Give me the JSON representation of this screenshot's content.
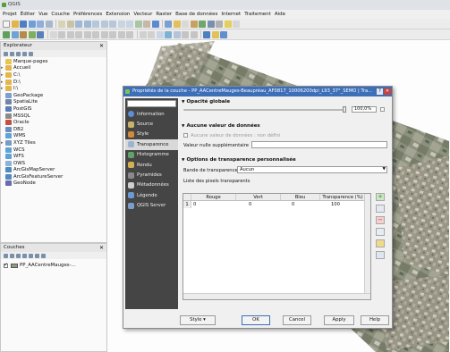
{
  "app": {
    "title": "QGIS"
  },
  "menu": [
    "Projet",
    "Éditer",
    "Vue",
    "Couche",
    "Préférences",
    "Extension",
    "Vecteur",
    "Raster",
    "Base de données",
    "Internet",
    "Traitement",
    "Aide"
  ],
  "explorer": {
    "title": "Explorateur",
    "items": [
      {
        "label": "Marque-pages",
        "icon": "star-icon",
        "color": "#e8c64a"
      },
      {
        "label": "Accueil",
        "icon": "folder-icon",
        "color": "#e5b54d"
      },
      {
        "label": "C:\\",
        "icon": "folder-icon",
        "color": "#e5b54d"
      },
      {
        "label": "D:\\",
        "icon": "folder-icon",
        "color": "#e5b54d"
      },
      {
        "label": "I:\\",
        "icon": "folder-icon",
        "color": "#e5b54d"
      },
      {
        "label": "GeoPackage",
        "icon": "geopackage-icon",
        "color": "#7b9fd4"
      },
      {
        "label": "SpatiaLite",
        "icon": "spatialite-icon",
        "color": "#6f86a5"
      },
      {
        "label": "PostGIS",
        "icon": "postgis-icon",
        "color": "#5a7db5"
      },
      {
        "label": "MSSQL",
        "icon": "mssql-icon",
        "color": "#8a8a8a"
      },
      {
        "label": "Oracle",
        "icon": "oracle-icon",
        "color": "#c7503c"
      },
      {
        "label": "DB2",
        "icon": "db2-icon",
        "color": "#6a8fbf"
      },
      {
        "label": "WMS",
        "icon": "wms-icon",
        "color": "#5fa3d6"
      },
      {
        "label": "XYZ Tiles",
        "icon": "xyz-tiles-icon",
        "color": "#7a9bc2"
      },
      {
        "label": "WCS",
        "icon": "wcs-icon",
        "color": "#5fa3d6"
      },
      {
        "label": "WFS",
        "icon": "wfs-icon",
        "color": "#5fa3d6"
      },
      {
        "label": "OWS",
        "icon": "ows-icon",
        "color": "#8fb1d6"
      },
      {
        "label": "ArcGisMapServer",
        "icon": "arcgis-map-icon",
        "color": "#4f8bbf"
      },
      {
        "label": "ArcGisFeatureServer",
        "icon": "arcgis-feature-icon",
        "color": "#4f8bbf"
      },
      {
        "label": "GeoNode",
        "icon": "geonode-icon",
        "color": "#6a6ab3"
      }
    ]
  },
  "layers": {
    "title": "Couches",
    "item": "PP_AACentreMauges-..."
  },
  "dialog": {
    "title": "Propriétés de la couche - PP_AACentreMauges-Beaupréau_AF0817_10006200dpi_L93_37°_SEMO | Tra...",
    "help": "?",
    "close": "✕",
    "sidebar": [
      {
        "label": "Information",
        "icon": "info-icon",
        "color": "#5b8fd6"
      },
      {
        "label": "Source",
        "icon": "source-icon",
        "color": "#c9b26a"
      },
      {
        "label": "Style",
        "icon": "style-icon",
        "color": "#d08a3c"
      },
      {
        "label": "Transparence",
        "icon": "transparency-icon",
        "color": "#9bb4d0",
        "active": true
      },
      {
        "label": "Histogramme",
        "icon": "histogram-icon",
        "color": "#5fa36a"
      },
      {
        "label": "Rendu",
        "icon": "render-icon",
        "color": "#d4b052"
      },
      {
        "label": "Pyramides",
        "icon": "pyramid-icon",
        "color": "#8a8a8a"
      },
      {
        "label": "Métadonnées",
        "icon": "metadata-icon",
        "color": "#cfcfcf"
      },
      {
        "label": "Légende",
        "icon": "legend-icon",
        "color": "#6a9ad0"
      },
      {
        "label": "QGIS Server",
        "icon": "server-icon",
        "color": "#7c9cc9"
      }
    ],
    "global_opacity": {
      "heading": "Opacité globale",
      "value": "100,0%",
      "level": 1.0
    },
    "nodata": {
      "heading": "Aucune valeur de données",
      "checkbox_label": "Aucune valeur de données : non défini",
      "extra_label": "Valeur nulle supplémentaire"
    },
    "custom": {
      "heading": "Options de transparence personnalisée",
      "band_label": "Bande de transparence",
      "band_value": "Aucun",
      "list_label": "Liste des pixels transparents",
      "columns": [
        "Rouge",
        "Vert",
        "Bleu",
        "Transparence (%)"
      ],
      "rows": [
        {
          "num": "1",
          "cells": [
            "0",
            "0",
            "0",
            "100"
          ]
        }
      ]
    },
    "footer": {
      "style": "Style",
      "ok": "OK",
      "cancel": "Cancel",
      "apply": "Apply",
      "help": "Help"
    }
  },
  "colors": {
    "dialog_title": "#3d6fb8",
    "sidebar": "#454545",
    "sidebar_active": "#d9d9d9",
    "map_photo": "#8a8f7e"
  }
}
